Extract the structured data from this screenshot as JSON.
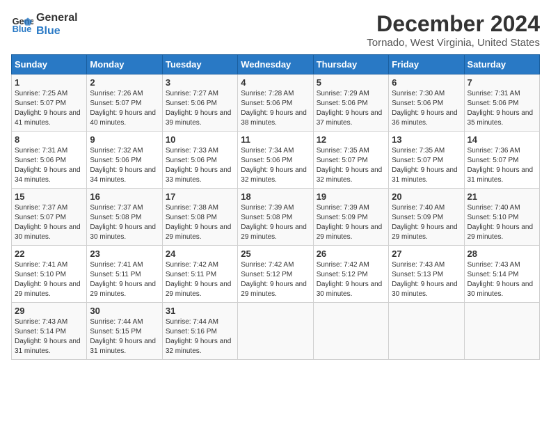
{
  "logo": {
    "line1": "General",
    "line2": "Blue"
  },
  "title": "December 2024",
  "subtitle": "Tornado, West Virginia, United States",
  "days_header": [
    "Sunday",
    "Monday",
    "Tuesday",
    "Wednesday",
    "Thursday",
    "Friday",
    "Saturday"
  ],
  "weeks": [
    [
      {
        "day": "1",
        "sunrise": "Sunrise: 7:25 AM",
        "sunset": "Sunset: 5:07 PM",
        "daylight": "Daylight: 9 hours and 41 minutes."
      },
      {
        "day": "2",
        "sunrise": "Sunrise: 7:26 AM",
        "sunset": "Sunset: 5:07 PM",
        "daylight": "Daylight: 9 hours and 40 minutes."
      },
      {
        "day": "3",
        "sunrise": "Sunrise: 7:27 AM",
        "sunset": "Sunset: 5:06 PM",
        "daylight": "Daylight: 9 hours and 39 minutes."
      },
      {
        "day": "4",
        "sunrise": "Sunrise: 7:28 AM",
        "sunset": "Sunset: 5:06 PM",
        "daylight": "Daylight: 9 hours and 38 minutes."
      },
      {
        "day": "5",
        "sunrise": "Sunrise: 7:29 AM",
        "sunset": "Sunset: 5:06 PM",
        "daylight": "Daylight: 9 hours and 37 minutes."
      },
      {
        "day": "6",
        "sunrise": "Sunrise: 7:30 AM",
        "sunset": "Sunset: 5:06 PM",
        "daylight": "Daylight: 9 hours and 36 minutes."
      },
      {
        "day": "7",
        "sunrise": "Sunrise: 7:31 AM",
        "sunset": "Sunset: 5:06 PM",
        "daylight": "Daylight: 9 hours and 35 minutes."
      }
    ],
    [
      {
        "day": "8",
        "sunrise": "Sunrise: 7:31 AM",
        "sunset": "Sunset: 5:06 PM",
        "daylight": "Daylight: 9 hours and 34 minutes."
      },
      {
        "day": "9",
        "sunrise": "Sunrise: 7:32 AM",
        "sunset": "Sunset: 5:06 PM",
        "daylight": "Daylight: 9 hours and 34 minutes."
      },
      {
        "day": "10",
        "sunrise": "Sunrise: 7:33 AM",
        "sunset": "Sunset: 5:06 PM",
        "daylight": "Daylight: 9 hours and 33 minutes."
      },
      {
        "day": "11",
        "sunrise": "Sunrise: 7:34 AM",
        "sunset": "Sunset: 5:06 PM",
        "daylight": "Daylight: 9 hours and 32 minutes."
      },
      {
        "day": "12",
        "sunrise": "Sunrise: 7:35 AM",
        "sunset": "Sunset: 5:07 PM",
        "daylight": "Daylight: 9 hours and 32 minutes."
      },
      {
        "day": "13",
        "sunrise": "Sunrise: 7:35 AM",
        "sunset": "Sunset: 5:07 PM",
        "daylight": "Daylight: 9 hours and 31 minutes."
      },
      {
        "day": "14",
        "sunrise": "Sunrise: 7:36 AM",
        "sunset": "Sunset: 5:07 PM",
        "daylight": "Daylight: 9 hours and 31 minutes."
      }
    ],
    [
      {
        "day": "15",
        "sunrise": "Sunrise: 7:37 AM",
        "sunset": "Sunset: 5:07 PM",
        "daylight": "Daylight: 9 hours and 30 minutes."
      },
      {
        "day": "16",
        "sunrise": "Sunrise: 7:37 AM",
        "sunset": "Sunset: 5:08 PM",
        "daylight": "Daylight: 9 hours and 30 minutes."
      },
      {
        "day": "17",
        "sunrise": "Sunrise: 7:38 AM",
        "sunset": "Sunset: 5:08 PM",
        "daylight": "Daylight: 9 hours and 29 minutes."
      },
      {
        "day": "18",
        "sunrise": "Sunrise: 7:39 AM",
        "sunset": "Sunset: 5:08 PM",
        "daylight": "Daylight: 9 hours and 29 minutes."
      },
      {
        "day": "19",
        "sunrise": "Sunrise: 7:39 AM",
        "sunset": "Sunset: 5:09 PM",
        "daylight": "Daylight: 9 hours and 29 minutes."
      },
      {
        "day": "20",
        "sunrise": "Sunrise: 7:40 AM",
        "sunset": "Sunset: 5:09 PM",
        "daylight": "Daylight: 9 hours and 29 minutes."
      },
      {
        "day": "21",
        "sunrise": "Sunrise: 7:40 AM",
        "sunset": "Sunset: 5:10 PM",
        "daylight": "Daylight: 9 hours and 29 minutes."
      }
    ],
    [
      {
        "day": "22",
        "sunrise": "Sunrise: 7:41 AM",
        "sunset": "Sunset: 5:10 PM",
        "daylight": "Daylight: 9 hours and 29 minutes."
      },
      {
        "day": "23",
        "sunrise": "Sunrise: 7:41 AM",
        "sunset": "Sunset: 5:11 PM",
        "daylight": "Daylight: 9 hours and 29 minutes."
      },
      {
        "day": "24",
        "sunrise": "Sunrise: 7:42 AM",
        "sunset": "Sunset: 5:11 PM",
        "daylight": "Daylight: 9 hours and 29 minutes."
      },
      {
        "day": "25",
        "sunrise": "Sunrise: 7:42 AM",
        "sunset": "Sunset: 5:12 PM",
        "daylight": "Daylight: 9 hours and 29 minutes."
      },
      {
        "day": "26",
        "sunrise": "Sunrise: 7:42 AM",
        "sunset": "Sunset: 5:12 PM",
        "daylight": "Daylight: 9 hours and 30 minutes."
      },
      {
        "day": "27",
        "sunrise": "Sunrise: 7:43 AM",
        "sunset": "Sunset: 5:13 PM",
        "daylight": "Daylight: 9 hours and 30 minutes."
      },
      {
        "day": "28",
        "sunrise": "Sunrise: 7:43 AM",
        "sunset": "Sunset: 5:14 PM",
        "daylight": "Daylight: 9 hours and 30 minutes."
      }
    ],
    [
      {
        "day": "29",
        "sunrise": "Sunrise: 7:43 AM",
        "sunset": "Sunset: 5:14 PM",
        "daylight": "Daylight: 9 hours and 31 minutes."
      },
      {
        "day": "30",
        "sunrise": "Sunrise: 7:44 AM",
        "sunset": "Sunset: 5:15 PM",
        "daylight": "Daylight: 9 hours and 31 minutes."
      },
      {
        "day": "31",
        "sunrise": "Sunrise: 7:44 AM",
        "sunset": "Sunset: 5:16 PM",
        "daylight": "Daylight: 9 hours and 32 minutes."
      },
      null,
      null,
      null,
      null
    ]
  ]
}
